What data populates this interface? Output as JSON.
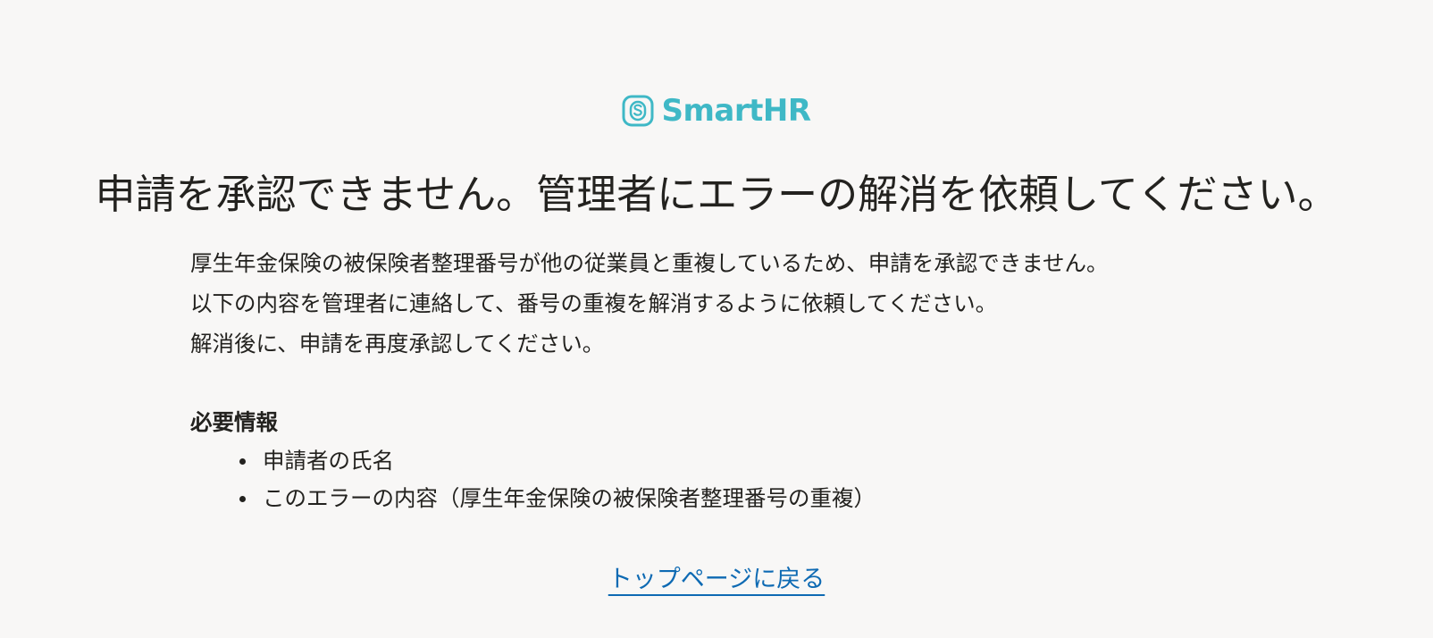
{
  "brand": {
    "name": "SmartHR",
    "logo_icon": "smarthr-logo-icon",
    "color": "#3fb8c6"
  },
  "error": {
    "title": "申請を承認できません。管理者にエラーの解消を依頼してください。",
    "paragraphs": [
      "厚生年金保険の被保険者整理番号が他の従業員と重複しているため、申請を承認できません。",
      "以下の内容を管理者に連絡して、番号の重複を解消するように依頼してください。",
      "解消後に、申請を再度承認してください。"
    ]
  },
  "required_info": {
    "heading": "必要情報",
    "items": [
      "申請者の氏名",
      "このエラーの内容（厚生年金保険の被保険者整理番号の重複）"
    ]
  },
  "back_link": {
    "label": "トップページに戻る",
    "color": "#0e6ab3"
  }
}
